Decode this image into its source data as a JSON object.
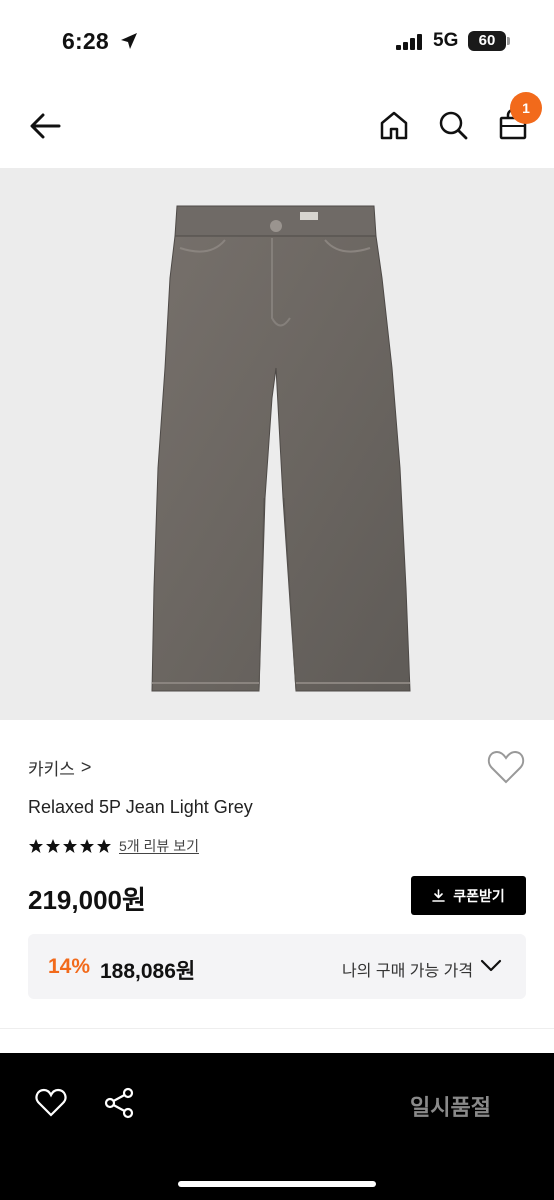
{
  "status_bar": {
    "time": "6:28",
    "network": "5G",
    "battery": "60"
  },
  "header": {
    "cart_count": "1",
    "icons": [
      "arrow-left-icon",
      "home-icon",
      "search-icon",
      "shopping-bag-icon"
    ]
  },
  "product": {
    "brand": "카키스",
    "brand_chevron": ">",
    "name": "Relaxed 5P Jean Light Grey",
    "rating_stars": 5,
    "review_link": "5개 리뷰 보기",
    "price": "219,000원",
    "coupon_label": "쿠폰받기",
    "discount": "14%",
    "sale_price": "188,086원",
    "my_price_label": "나의 구매 가능 가격"
  },
  "bottom_bar": {
    "status_label": "일시품절"
  },
  "colors": {
    "accent": "#f26a1b",
    "black": "#000000",
    "image_bg": "#ececec",
    "box_bg": "#f4f4f6"
  }
}
